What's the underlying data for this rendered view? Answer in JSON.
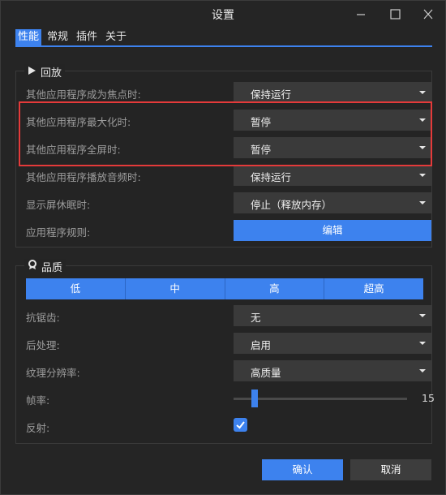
{
  "window": {
    "title": "设置"
  },
  "tabs": [
    "性能",
    "常规",
    "插件",
    "关于"
  ],
  "playback": {
    "title": "回放",
    "rows": [
      {
        "label": "其他应用程序成为焦点时:",
        "value": "保持运行"
      },
      {
        "label": "其他应用程序最大化时:",
        "value": "暂停"
      },
      {
        "label": "其他应用程序全屏时:",
        "value": "暂停"
      },
      {
        "label": "其他应用程序播放音频时:",
        "value": "保持运行"
      },
      {
        "label": "显示屏休眠时:",
        "value": "停止（释放内存）"
      }
    ],
    "rules": {
      "label": "应用程序规则:",
      "button": "编辑"
    }
  },
  "quality": {
    "title": "品质",
    "presets": [
      "低",
      "中",
      "高",
      "超高"
    ],
    "selected_preset": "高",
    "antialias": {
      "label": "抗锯齿:",
      "value": "无"
    },
    "postprocess": {
      "label": "后处理:",
      "value": "启用"
    },
    "texture": {
      "label": "纹理分辨率:",
      "value": "高质量"
    },
    "fps": {
      "label": "帧率:",
      "value": "15"
    },
    "reflection": {
      "label": "反射:",
      "checked": true
    }
  },
  "footer": {
    "ok": "确认",
    "cancel": "取消"
  },
  "colors": {
    "accent": "#3d82ee",
    "highlight_border": "#e43a3a"
  }
}
